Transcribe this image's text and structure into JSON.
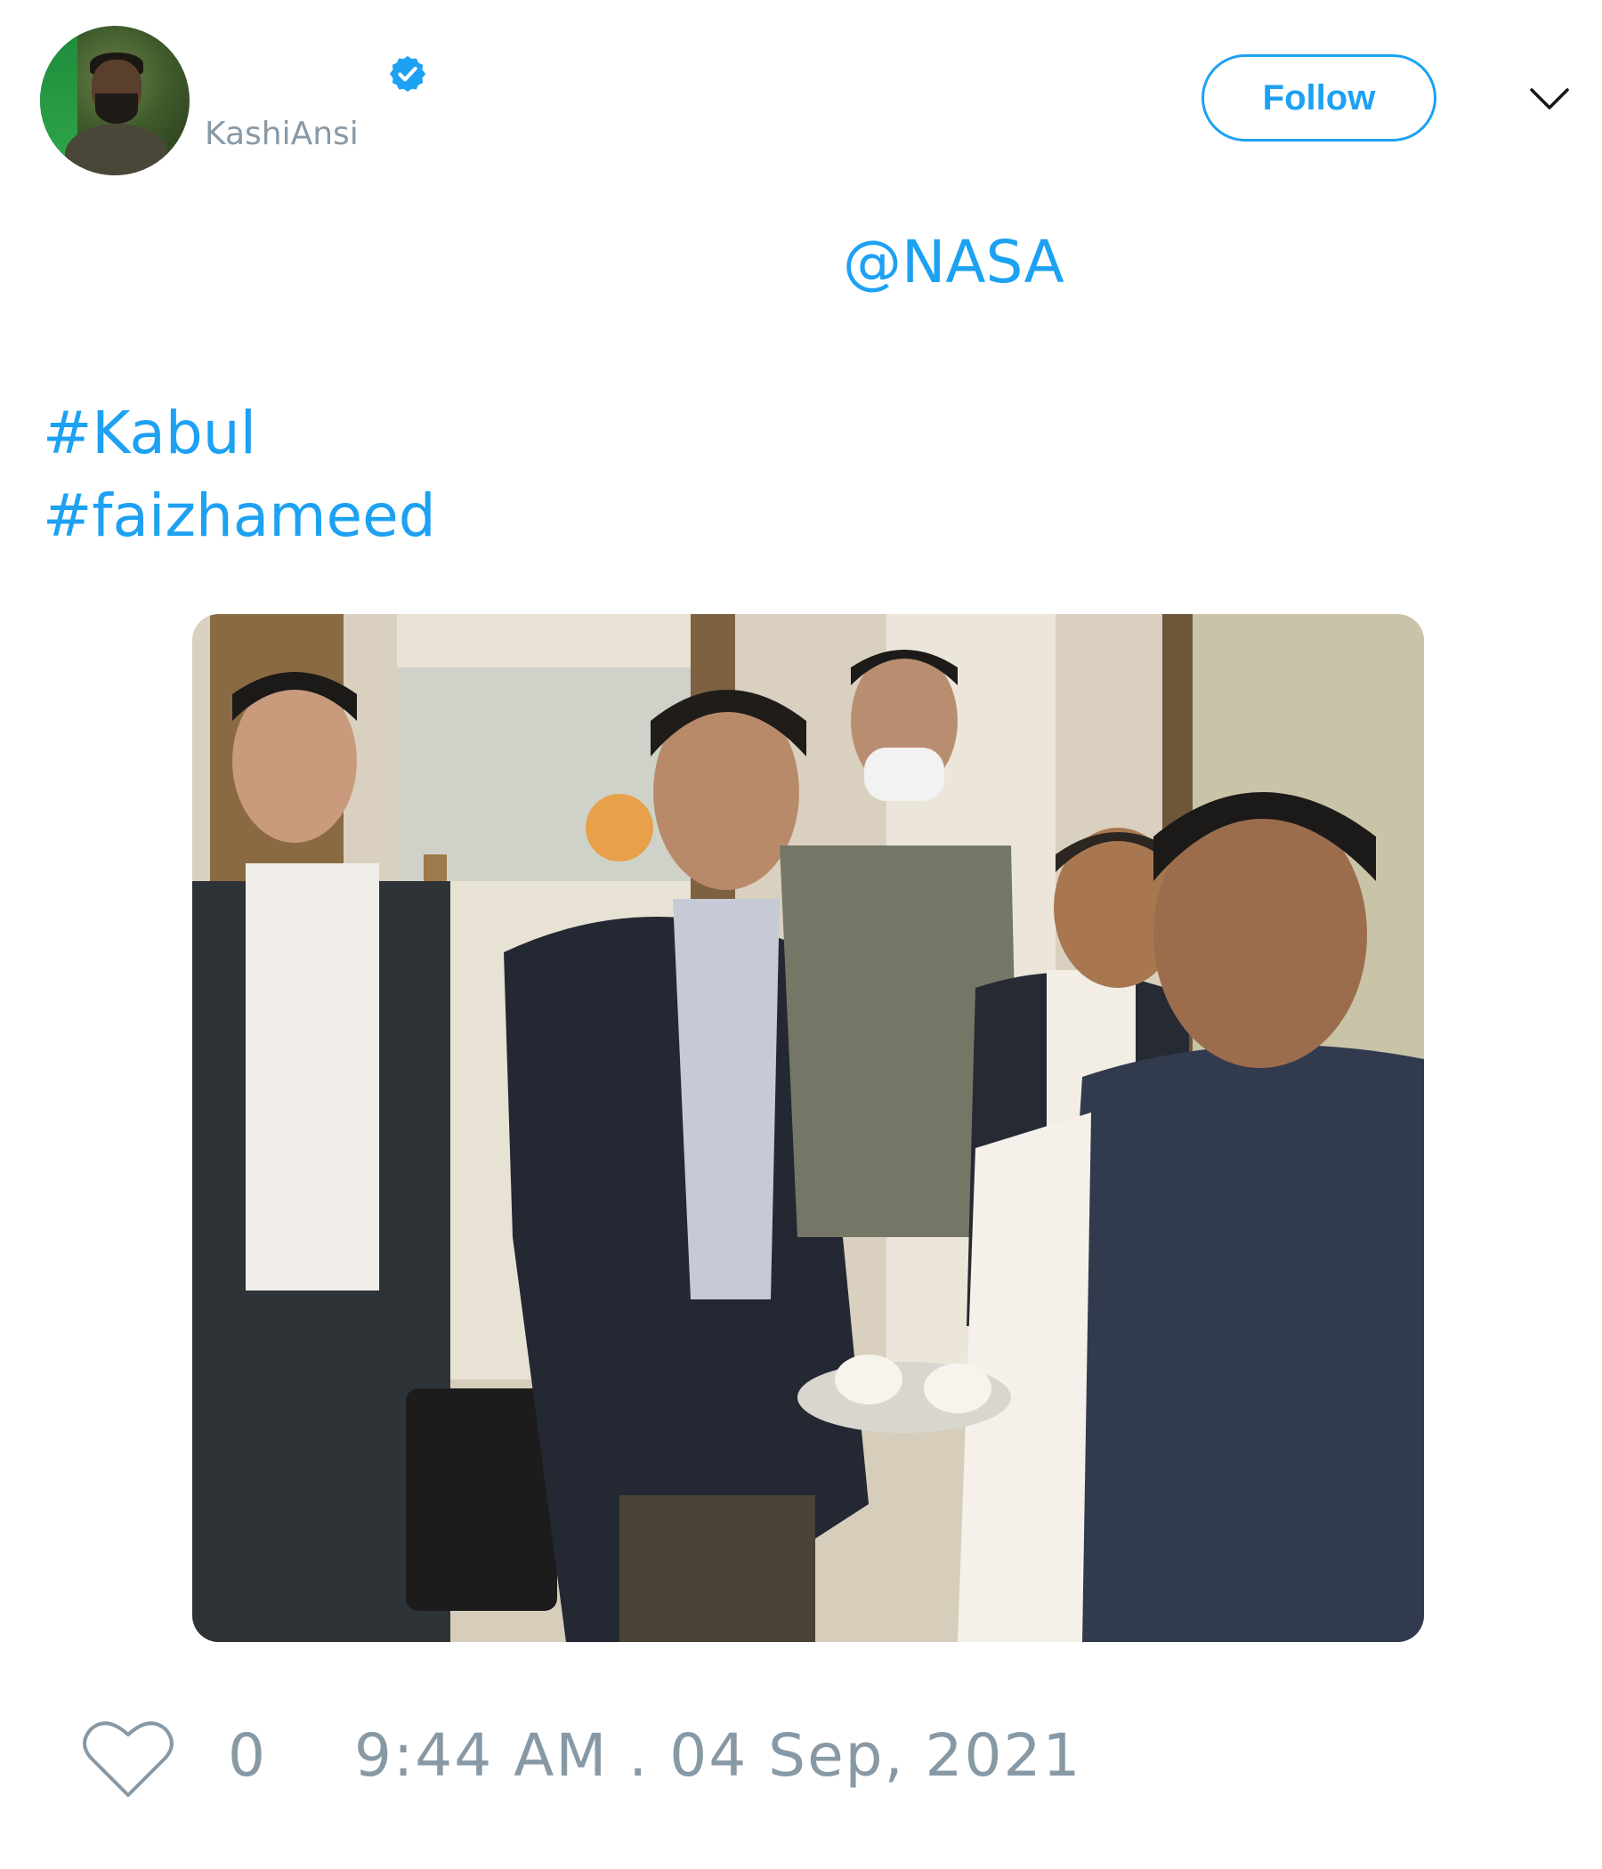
{
  "user": {
    "avatar_icon": "user-avatar",
    "verified_icon": "verified-badge-icon",
    "handle": "KashiAnsi"
  },
  "header": {
    "follow_label": "Follow",
    "menu_icon": "chevron-down-icon"
  },
  "tweet": {
    "mention": "@NASA",
    "hashtags": [
      "#Kabul",
      "#faizhameed"
    ]
  },
  "media": {
    "kind": "photo"
  },
  "footer": {
    "like_icon": "heart-icon",
    "like_count": "0",
    "timestamp": "9:44 AM . 04 Sep, 2021"
  },
  "colors": {
    "accent": "#1da1f2",
    "muted": "#8899a6"
  }
}
